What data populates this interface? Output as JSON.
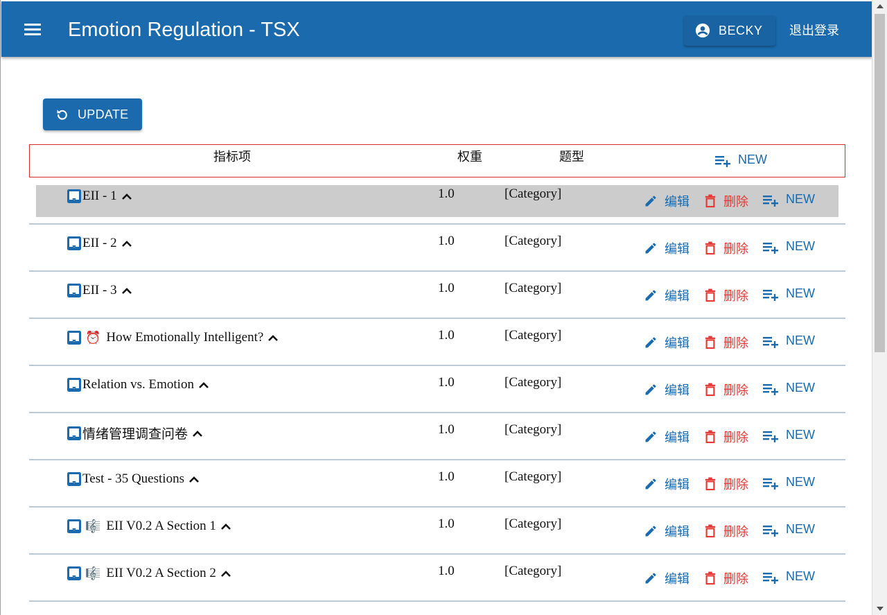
{
  "app": {
    "title": "Emotion Regulation - TSX",
    "user_label": "BECKY",
    "logout_label": "退出登录"
  },
  "toolbar": {
    "update_label": "UPDATE"
  },
  "table": {
    "headers": {
      "name": "指标项",
      "weight": "权重",
      "type": "题型",
      "new": "NEW"
    },
    "action_labels": {
      "edit": "编辑",
      "delete": "删除",
      "new": "NEW"
    },
    "rows": [
      {
        "name": "EII - 1",
        "emoji": "",
        "weight": "1.0",
        "type": "[Category]",
        "selected": true
      },
      {
        "name": "EII - 2",
        "emoji": "",
        "weight": "1.0",
        "type": "[Category]",
        "selected": false
      },
      {
        "name": "EII - 3",
        "emoji": "",
        "weight": "1.0",
        "type": "[Category]",
        "selected": false
      },
      {
        "name": "How Emotionally Intelligent?",
        "emoji": "⏰",
        "weight": "1.0",
        "type": "[Category]",
        "selected": false
      },
      {
        "name": "Relation vs. Emotion",
        "emoji": "",
        "weight": "1.0",
        "type": "[Category]",
        "selected": false
      },
      {
        "name": "情绪管理调查问卷",
        "emoji": "",
        "weight": "1.0",
        "type": "[Category]",
        "selected": false
      },
      {
        "name": "Test - 35 Questions",
        "emoji": "",
        "weight": "1.0",
        "type": "[Category]",
        "selected": false
      },
      {
        "name": "EII V0.2 A Section 1",
        "emoji": "🎼",
        "weight": "1.0",
        "type": "[Category]",
        "selected": false
      },
      {
        "name": "EII V0.2 A Section 2",
        "emoji": "🎼",
        "weight": "1.0",
        "type": "[Category]",
        "selected": false
      }
    ]
  },
  "colors": {
    "primary": "#1a6aad",
    "danger": "#e53935",
    "selected_row": "#cbcccb"
  }
}
